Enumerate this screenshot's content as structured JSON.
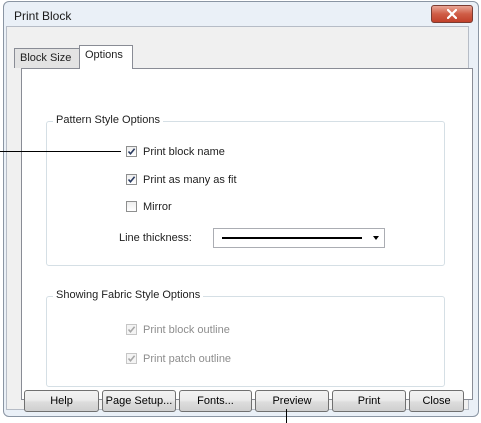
{
  "window": {
    "title": "Print Block"
  },
  "tabs": [
    {
      "label": "Block Size",
      "active": false
    },
    {
      "label": "Options",
      "active": true
    }
  ],
  "pattern_group": {
    "legend": "Pattern Style Options",
    "checkboxes": [
      {
        "label": "Print block name",
        "checked": true
      },
      {
        "label": "Print as many as fit",
        "checked": true
      },
      {
        "label": "Mirror",
        "checked": false
      }
    ],
    "line_thickness": {
      "label": "Line thickness:",
      "value": "thick solid line"
    }
  },
  "fabric_group": {
    "legend": "Showing Fabric Style Options",
    "checkboxes": [
      {
        "label": "Print block outline",
        "checked": true,
        "disabled": true
      },
      {
        "label": "Print patch outline",
        "checked": true,
        "disabled": true
      }
    ]
  },
  "buttons": {
    "help": "Help",
    "page_setup": "Page Setup...",
    "fonts": "Fonts...",
    "preview": "Preview",
    "print": "Print",
    "close": "Close"
  },
  "icons": {
    "close": "x-icon",
    "check": "checkmark-icon"
  },
  "colors": {
    "close_button": "#c1402a",
    "window_bg": "#f0f0f0",
    "frame": "#eaf0f7"
  }
}
